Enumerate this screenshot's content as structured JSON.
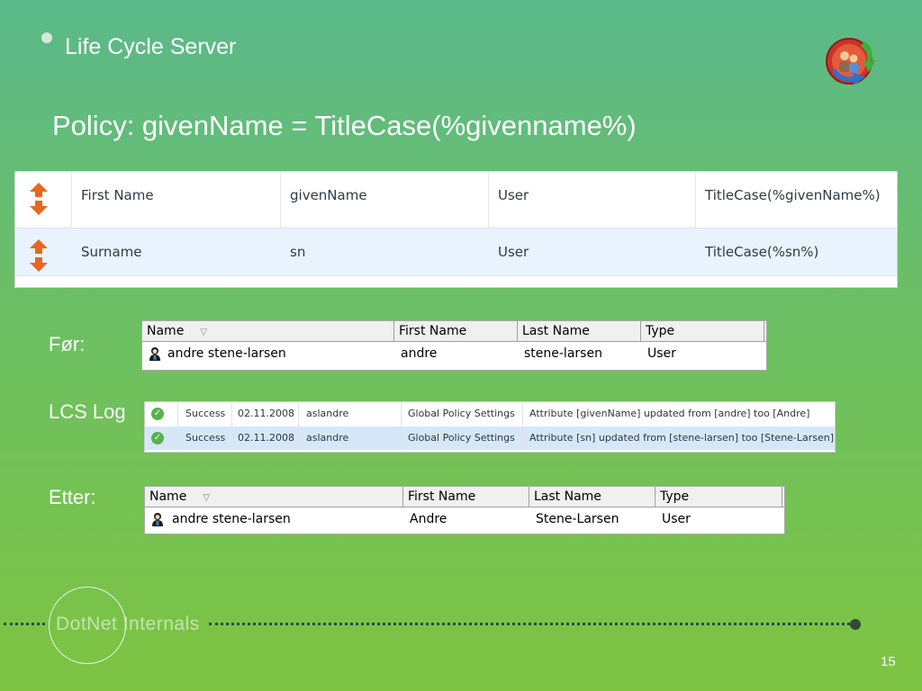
{
  "slide": {
    "title": "Life Cycle Server",
    "policy": "Policy: givenName = TitleCase(%givenname%)",
    "page_number": "15",
    "footer_logo": "DotNet Internals"
  },
  "policy_grid": [
    {
      "label": "First Name",
      "attribute": "givenName",
      "object": "User",
      "rule": "TitleCase(%givenName%)"
    },
    {
      "label": "Surname",
      "attribute": "sn",
      "object": "User",
      "rule": "TitleCase(%sn%)"
    }
  ],
  "before": {
    "label": "Før:",
    "headers": [
      "Name",
      "First Name",
      "Last Name",
      "Type"
    ],
    "row": {
      "name": "andre stene-larsen",
      "first": "andre",
      "last": "stene-larsen",
      "type": "User"
    }
  },
  "log": {
    "label": "LCS Log",
    "rows": [
      {
        "status": "Success",
        "date": "02.11.2008",
        "user": "aslandre",
        "source": "Global Policy Settings",
        "message": "Attribute [givenName] updated from [andre] too [Andre]"
      },
      {
        "status": "Success",
        "date": "02.11.2008",
        "user": "aslandre",
        "source": "Global Policy Settings",
        "message": "Attribute [sn] updated from [stene-larsen] too [Stene-Larsen]"
      }
    ]
  },
  "after": {
    "label": "Etter:",
    "headers": [
      "Name",
      "First Name",
      "Last Name",
      "Type"
    ],
    "row": {
      "name": "andre stene-larsen",
      "first": "Andre",
      "last": "Stene-Larsen",
      "type": "User"
    }
  },
  "icons": {
    "bullet": "bullet-dot",
    "logo": "life-cycle-server-logo-icon",
    "reorder": "up-down-arrows-icon",
    "user": "user-icon",
    "success": "check-icon",
    "sort": "sort-triangle-icon"
  },
  "colors": {
    "accent_orange": "#e8671f",
    "success_green": "#58b24a",
    "selected_row": "#d6e8f8"
  }
}
